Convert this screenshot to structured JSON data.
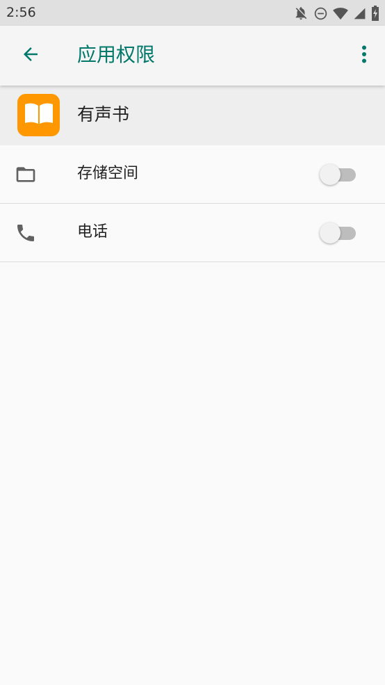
{
  "status_bar": {
    "time": "2:56",
    "icons": [
      "notifications-off-icon",
      "do-not-disturb-icon",
      "wifi-icon",
      "cell-signal-icon",
      "battery-charging-icon"
    ]
  },
  "app_bar": {
    "title": "应用权限",
    "accent_color": "#00796b"
  },
  "app": {
    "name": "有声书",
    "icon": "open-book-icon",
    "icon_color": "#ff9800"
  },
  "permissions": [
    {
      "label": "存储空间",
      "icon": "folder-icon",
      "enabled": false
    },
    {
      "label": "电话",
      "icon": "phone-icon",
      "enabled": false
    }
  ]
}
